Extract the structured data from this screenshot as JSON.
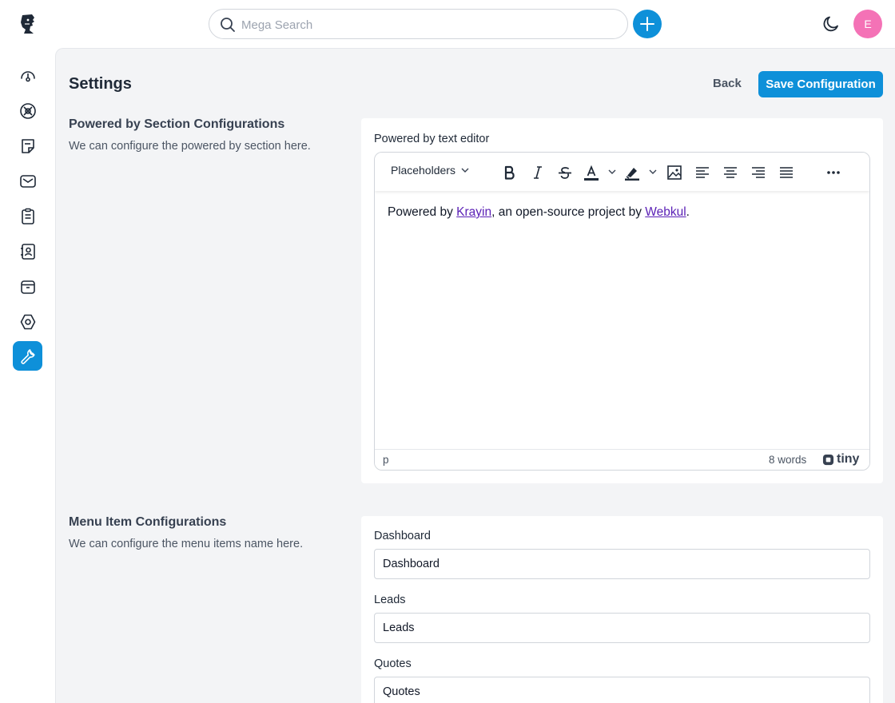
{
  "header": {
    "search": {
      "placeholder": "Mega Search"
    },
    "avatar_initial": "E"
  },
  "sidebar": {
    "items": [
      {
        "name": "dashboard",
        "icon": "gauge-icon"
      },
      {
        "name": "leads",
        "icon": "leads-icon"
      },
      {
        "name": "quotes",
        "icon": "note-icon"
      },
      {
        "name": "mail",
        "icon": "mail-icon"
      },
      {
        "name": "activities",
        "icon": "clipboard-icon"
      },
      {
        "name": "contacts",
        "icon": "contact-book-icon"
      },
      {
        "name": "products",
        "icon": "box-icon"
      },
      {
        "name": "settings",
        "icon": "hexagon-settings-icon"
      },
      {
        "name": "configuration",
        "icon": "wrench-icon",
        "active": true
      }
    ]
  },
  "page": {
    "title": "Settings",
    "back_label": "Back",
    "save_label": "Save Configuration"
  },
  "powered_by": {
    "title": "Powered by Section Configurations",
    "description": "We can configure the powered by section here.",
    "field_label": "Powered by text editor",
    "editor": {
      "placeholders_label": "Placeholders",
      "content_prefix": "Powered by ",
      "link1": "Krayin",
      "content_middle": ", an open-source project by ",
      "link2": "Webkul",
      "content_suffix": ".",
      "path": "p",
      "word_count": "8 words",
      "brand": "tiny"
    }
  },
  "menu_items": {
    "title": "Menu Item Configurations",
    "description": "We can configure the menu items name here.",
    "fields": [
      {
        "label": "Dashboard",
        "value": "Dashboard"
      },
      {
        "label": "Leads",
        "value": "Leads"
      },
      {
        "label": "Quotes",
        "value": "Quotes"
      }
    ]
  },
  "colors": {
    "primary": "#0e90d9",
    "avatar": "#f472b6",
    "link": "#5b21b6",
    "background": "#f3f4f6"
  }
}
